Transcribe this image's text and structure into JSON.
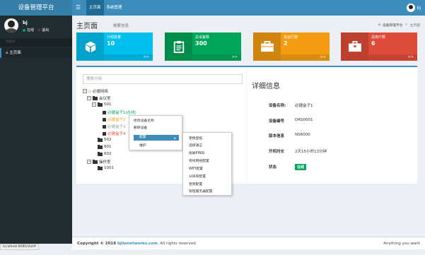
{
  "header": {
    "logo": "设备管理平台",
    "menu_icon": "☰",
    "nav": [
      "主页面",
      "系统管理"
    ],
    "user": "bj"
  },
  "sidebar": {
    "user_name": "bj",
    "status_online": "在线",
    "logout": "退出",
    "section_label": "导航栏",
    "items": [
      {
        "label": "主页面",
        "icon": "home-icon"
      }
    ]
  },
  "page": {
    "title": "主页面",
    "subtitle": "概要信息",
    "breadcrumb": [
      "设备管理平台",
      "主页面"
    ]
  },
  "stats": [
    {
      "label": "分组数量",
      "value": "10",
      "more": ">>",
      "color": "#00c0ef",
      "icon": "cube-icon"
    },
    {
      "label": "总设备数",
      "value": "300",
      "more": ">>",
      "color": "#00a65a",
      "icon": "clipboard-icon"
    },
    {
      "label": "总运行数",
      "value": "2",
      "more": ">>",
      "color": "#f39c12",
      "icon": "briefcase-icon"
    },
    {
      "label": "总用户数",
      "value": "6",
      "more": ">>",
      "color": "#dd4b39",
      "icon": "id-card-icon"
    }
  ],
  "search": {
    "placeholder": "搜索分组"
  },
  "tree": {
    "root": "必捷网络",
    "room": "会议室",
    "n501": "501",
    "d1": "必捷盒子1(在线)",
    "d2": "必捷盒子2",
    "d3": "必捷盒子3",
    "d4": "必捷盒子4",
    "n502": "502",
    "n601": "601",
    "n602": "602",
    "office": "操作室",
    "n1001": "1001"
  },
  "context_menu": {
    "items": [
      "修改设备名称",
      "删除设备",
      "配置",
      "维护"
    ]
  },
  "submenu": {
    "items": [
      "更换壁纸",
      "选择语言",
      "投屏PIN码",
      "有线网络配置",
      "WIFI配置",
      "分辨率配置",
      "音频配置",
      "管理服务器配置"
    ]
  },
  "detail": {
    "title": "详细信息",
    "fields": [
      {
        "label": "设备名称:",
        "value": "必捷盒子1"
      },
      {
        "label": "设备编号",
        "value": "DRS0001"
      },
      {
        "label": "版本信息",
        "value": "NS6000"
      },
      {
        "label": "开机时长",
        "value": "2天15小时13分钟"
      },
      {
        "label": "状态",
        "value": ""
      }
    ],
    "status": "在线"
  },
  "footer": {
    "copyright_prefix": "Copyright © 2018 ",
    "copyright_link": "bjiienetworks.com",
    "copyright_suffix": ". All rights reserved.",
    "right": "Anything you want"
  },
  "statusbar": "localhost:8080/stat#",
  "colors": {
    "primary": "#3c8dbc",
    "sidebar": "#222d32",
    "online": "#00a65a",
    "offline": "#999999",
    "warning": "#f39c12",
    "danger": "#dd4b39"
  }
}
